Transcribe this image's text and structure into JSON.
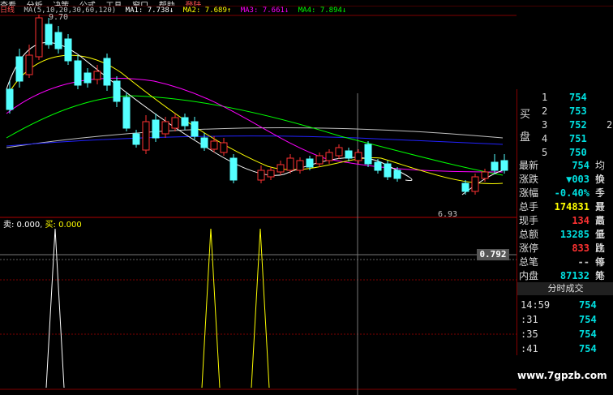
{
  "menu": [
    "查看",
    "分析",
    "决策",
    "公式",
    "工具",
    "窗口",
    "帮助",
    "登陆"
  ],
  "ma_bar": {
    "period_label": "日线",
    "params": "MA(5,10,20,30,60,120)",
    "items": [
      {
        "label": "MA1: 7.738↓",
        "color": "#ffffff"
      },
      {
        "label": "MA2: 7.689↑",
        "color": "#ffff00"
      },
      {
        "label": "MA3: 7.661↓",
        "color": "#ff00ff"
      },
      {
        "label": "MA4: 7.894↓",
        "color": "#00ff00"
      }
    ]
  },
  "chart": {
    "high_label": "9.70",
    "low_label": "6.93",
    "colors": {
      "up": "#ff3232",
      "down": "#54ffff",
      "ma1": "#ffffff",
      "ma2": "#ffff00",
      "ma3": "#ff00ff",
      "ma4": "#00ff00",
      "ma5": "#2222ff",
      "ma6": "#c0c0c0",
      "grid": "#800000"
    }
  },
  "indicator": {
    "label_sell": "卖: 0.000",
    "label_buy": "买: 0.000",
    "cursor_value": "0.792"
  },
  "bid_panel": {
    "side_label": "买盘",
    "rows": [
      {
        "n": "1",
        "price": "754",
        "vol": ""
      },
      {
        "n": "2",
        "price": "753",
        "vol": ""
      },
      {
        "n": "3",
        "price": "752",
        "vol": "2"
      },
      {
        "n": "4",
        "price": "751",
        "vol": ""
      },
      {
        "n": "5",
        "price": "750",
        "vol": ""
      }
    ]
  },
  "stats": [
    {
      "k": "最新",
      "v": "754",
      "c": "#00e0e0",
      "k2": "均价"
    },
    {
      "k": "涨跌",
      "v": "▼003",
      "c": "#00e0e0",
      "k2": "换手"
    },
    {
      "k": "涨幅",
      "v": "-0.40%",
      "c": "#00e0e0",
      "k2": "今开"
    },
    {
      "k": "总手",
      "v": "174831",
      "c": "#ffff00",
      "k2": "最高"
    },
    {
      "k": "现手",
      "v": "134",
      "c": "#ff3232",
      "k2": "最低"
    },
    {
      "k": "总额",
      "v": "13285",
      "c": "#00e0e0",
      "k2": "量比"
    },
    {
      "k": "涨停",
      "v": "833",
      "c": "#ff3232",
      "k2": "跌停"
    },
    {
      "k": "总笔",
      "v": "--",
      "c": "#c0c0c0",
      "k2": "每笔"
    },
    {
      "k": "内盘",
      "v": "87132",
      "c": "#00e0e0",
      "k2": "外盘"
    }
  ],
  "ticks_header": "分时成交",
  "ticks": [
    {
      "t": "14:59",
      "p": "754"
    },
    {
      "t": ":31",
      "p": "754"
    },
    {
      "t": ":35",
      "p": "754"
    },
    {
      "t": ":41",
      "p": "754"
    }
  ],
  "watermark": "www.7gpzb.com"
}
